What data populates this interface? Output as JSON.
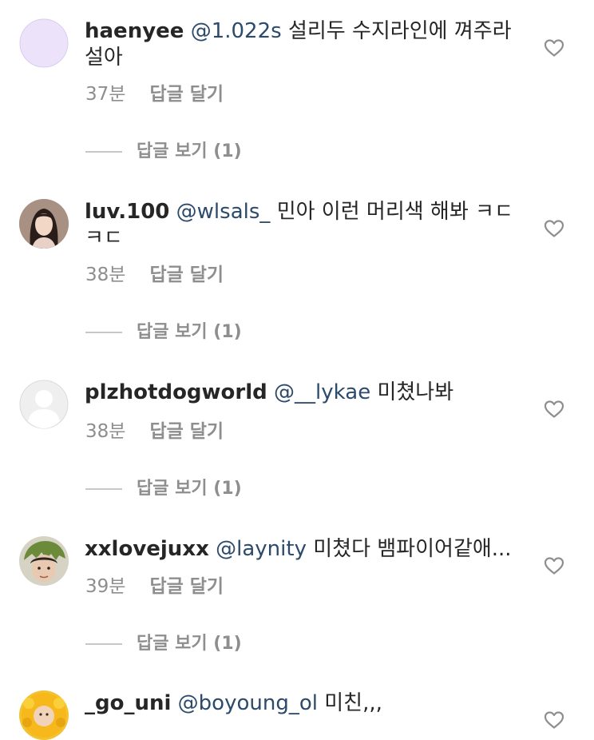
{
  "comments": [
    {
      "username": "haenyee",
      "mention": "@1.022s",
      "text": "설리두 수지라인에 껴주라 설아",
      "time": "37분",
      "reply_label": "답글 달기",
      "view_replies": "답글 보기 (1)",
      "avatar": "lavender-avatar"
    },
    {
      "username": "luv.100",
      "mention": "@wlsals_",
      "text": " 민아 이런 머리색 해봐 ㅋㄷ ㅋㄷ",
      "time": "38분",
      "reply_label": "답글 달기",
      "view_replies": "답글 보기 (1)",
      "avatar": "woman-photo-avatar"
    },
    {
      "username": "plzhotdogworld",
      "mention": "@__lykae",
      "text": "미쳤나봐",
      "time": "38분",
      "reply_label": "답글 달기",
      "view_replies": "답글 보기 (1)",
      "avatar": "default-person-avatar"
    },
    {
      "username": "xxlovejuxx",
      "mention": "@laynity",
      "text": "미쳤다 뱀파이어같애...",
      "time": "39분",
      "reply_label": "답글 달기",
      "view_replies": "답글 보기 (1)",
      "avatar": "dino-hat-avatar"
    },
    {
      "username": "_go_uni",
      "mention": "@boyoung_ol",
      "text": " 미친,,,",
      "avatar": "sunflower-avatar"
    }
  ],
  "colors": {
    "username": "#262626",
    "mention": "#2c4a6b",
    "meta": "#8e8e8e",
    "divider": "#c7c7c7"
  }
}
